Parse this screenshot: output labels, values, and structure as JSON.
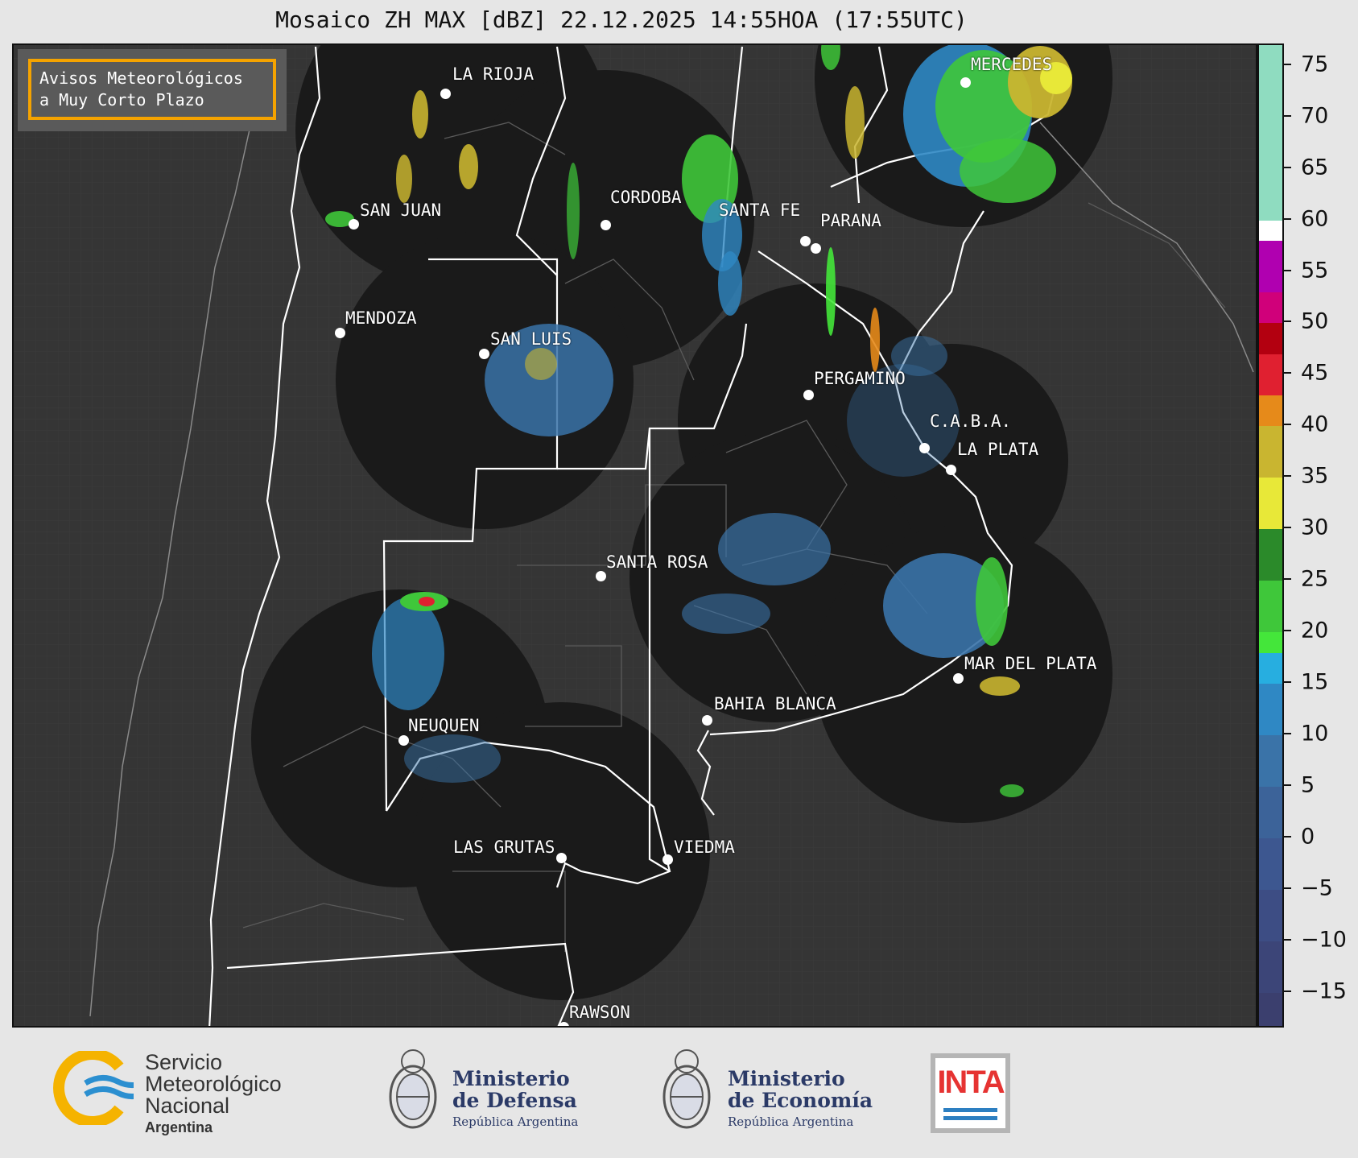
{
  "title": "Mosaico ZH MAX [dBZ] 22.12.2025 14:55HOA (17:55UTC)",
  "avisos": {
    "line1": "Avisos Meteorológicos",
    "line2": "a Muy Corto Plazo"
  },
  "cities": [
    {
      "name": "LA RIOJA"
    },
    {
      "name": "SAN JUAN"
    },
    {
      "name": "CORDOBA"
    },
    {
      "name": "SANTA FE"
    },
    {
      "name": "PARANA"
    },
    {
      "name": "MERCEDES"
    },
    {
      "name": "MENDOZA"
    },
    {
      "name": "SAN LUIS"
    },
    {
      "name": "PERGAMINO"
    },
    {
      "name": "C.A.B.A."
    },
    {
      "name": "LA PLATA"
    },
    {
      "name": "SANTA ROSA"
    },
    {
      "name": "MAR DEL PLATA"
    },
    {
      "name": "BAHIA BLANCA"
    },
    {
      "name": "NEUQUEN"
    },
    {
      "name": "LAS GRUTAS"
    },
    {
      "name": "VIEDMA"
    },
    {
      "name": "RAWSON"
    }
  ],
  "colorbar": {
    "ticks": [
      "75",
      "70",
      "65",
      "60",
      "55",
      "50",
      "45",
      "40",
      "35",
      "30",
      "25",
      "20",
      "15",
      "10",
      "5",
      "0",
      "−5",
      "−10",
      "−15"
    ],
    "tick_values": [
      75,
      70,
      65,
      60,
      55,
      50,
      45,
      40,
      35,
      30,
      25,
      20,
      15,
      10,
      5,
      0,
      -5,
      -10,
      -15
    ],
    "range": [
      -18.5,
      77
    ],
    "bands": [
      {
        "from": -18.5,
        "to": -15,
        "color": "#3b3f6e"
      },
      {
        "from": -15,
        "to": -10,
        "color": "#3c4578"
      },
      {
        "from": -10,
        "to": -5,
        "color": "#3d4d84"
      },
      {
        "from": -5,
        "to": 0,
        "color": "#3d5790"
      },
      {
        "from": 0,
        "to": 5,
        "color": "#3c6399"
      },
      {
        "from": 5,
        "to": 10,
        "color": "#3a73a8"
      },
      {
        "from": 10,
        "to": 15,
        "color": "#2f88c4"
      },
      {
        "from": 15,
        "to": 18,
        "color": "#27aee0"
      },
      {
        "from": 18,
        "to": 20,
        "color": "#44e63a"
      },
      {
        "from": 20,
        "to": 25,
        "color": "#3fc73a"
      },
      {
        "from": 25,
        "to": 30,
        "color": "#2b8a2a"
      },
      {
        "from": 30,
        "to": 35,
        "color": "#e8e838"
      },
      {
        "from": 35,
        "to": 40,
        "color": "#c9b530"
      },
      {
        "from": 40,
        "to": 43,
        "color": "#e68a1a"
      },
      {
        "from": 43,
        "to": 47,
        "color": "#e02030"
      },
      {
        "from": 47,
        "to": 50,
        "color": "#b30010"
      },
      {
        "from": 50,
        "to": 53,
        "color": "#d0007a"
      },
      {
        "from": 53,
        "to": 58,
        "color": "#b000b0"
      },
      {
        "from": 58,
        "to": 60,
        "color": "#ffffff"
      },
      {
        "from": 60,
        "to": 77,
        "color": "#8fdcc0"
      }
    ]
  },
  "footer": {
    "smn": {
      "line1": "Servicio",
      "line2": "Meteorológico",
      "line3": "Nacional",
      "line4": "Argentina"
    },
    "defensa": {
      "line1": "Ministerio",
      "line2": "de Defensa",
      "sub": "República Argentina"
    },
    "economia": {
      "line1": "Ministerio",
      "line2": "de Economía",
      "sub": "República Argentina"
    },
    "inta": "INTA"
  },
  "colors": {
    "radar_bg": "#1a1a1a",
    "land_bg": "#353535",
    "border": "#ffffff",
    "accent": "#f5a300"
  }
}
